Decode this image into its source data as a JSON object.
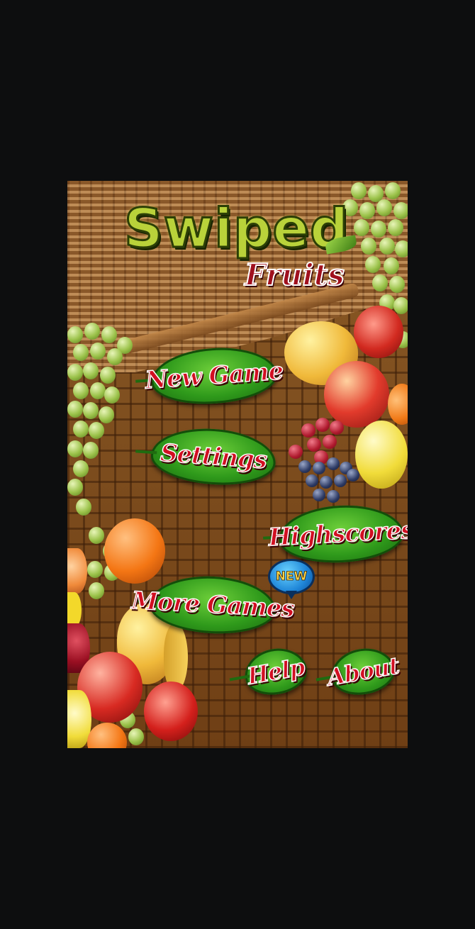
{
  "title": {
    "line1": "Swiped",
    "line2": "Fruits"
  },
  "menu": {
    "new_game": "New Game",
    "settings": "Settings",
    "highscores": "Highscores",
    "more_games": "More Games",
    "help": "Help",
    "about": "About"
  },
  "badge": {
    "new": "NEW"
  },
  "colors": {
    "background": "#0d0e0f",
    "button_leaf": "#2f9a1b",
    "button_text": "#d10f22",
    "badge": "#1f86d8",
    "badge_text": "#ffd64a"
  }
}
